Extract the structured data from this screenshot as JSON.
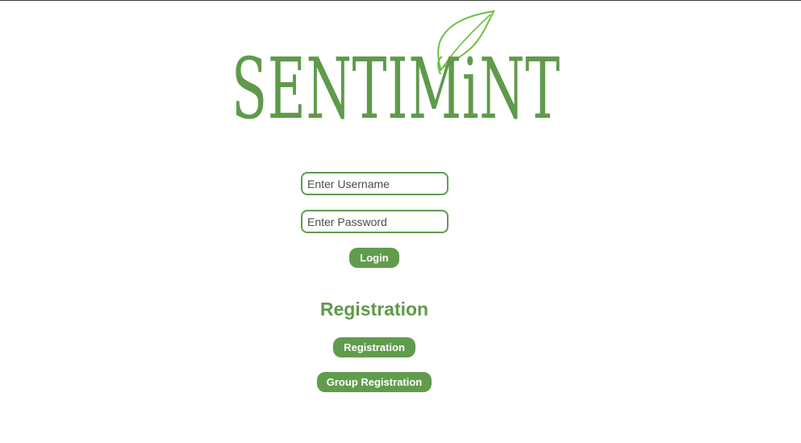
{
  "brand": {
    "logo_text": "SENTIMiNT",
    "logo_icon": "leaf-icon",
    "color": "#5f9a4b"
  },
  "login": {
    "username_placeholder": "Enter Username",
    "password_placeholder": "Enter Password",
    "login_label": "Login"
  },
  "registration": {
    "heading": "Registration",
    "registration_label": "Registration",
    "group_registration_label": "Group Registration"
  },
  "colors": {
    "accent": "#619c4d",
    "background": "#ffffff"
  }
}
